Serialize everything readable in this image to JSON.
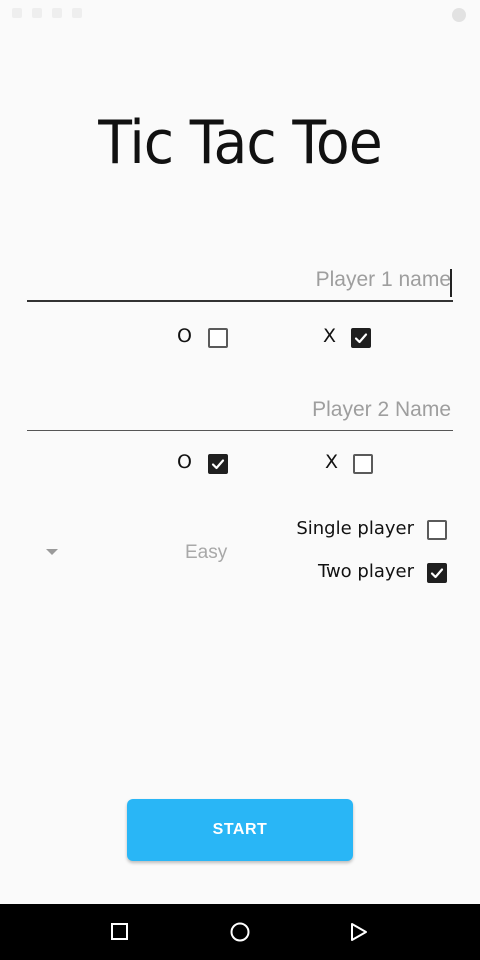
{
  "app": {
    "title": "Tic Tac Toe"
  },
  "player1": {
    "placeholder": "Player 1 name",
    "value": "",
    "o_label": "O",
    "x_label": "X",
    "o_checked": false,
    "x_checked": true
  },
  "player2": {
    "placeholder": "Player 2 Name",
    "value": "",
    "o_label": "O",
    "x_label": "X",
    "o_checked": true,
    "x_checked": false
  },
  "difficulty": {
    "selected": "Easy"
  },
  "mode": {
    "single_label": "Single player",
    "two_label": "Two player",
    "single_checked": false,
    "two_checked": true
  },
  "start_button": {
    "label": "START"
  },
  "colors": {
    "accent": "#29b6f6",
    "checkbox_checked": "#1f1f1f",
    "placeholder": "#9e9e9e",
    "nav_bar": "#000000"
  },
  "icons": {
    "dropdown": "triangle-down",
    "nav_recents": "square-outline",
    "nav_home": "circle-outline",
    "nav_back": "triangle-outline"
  }
}
